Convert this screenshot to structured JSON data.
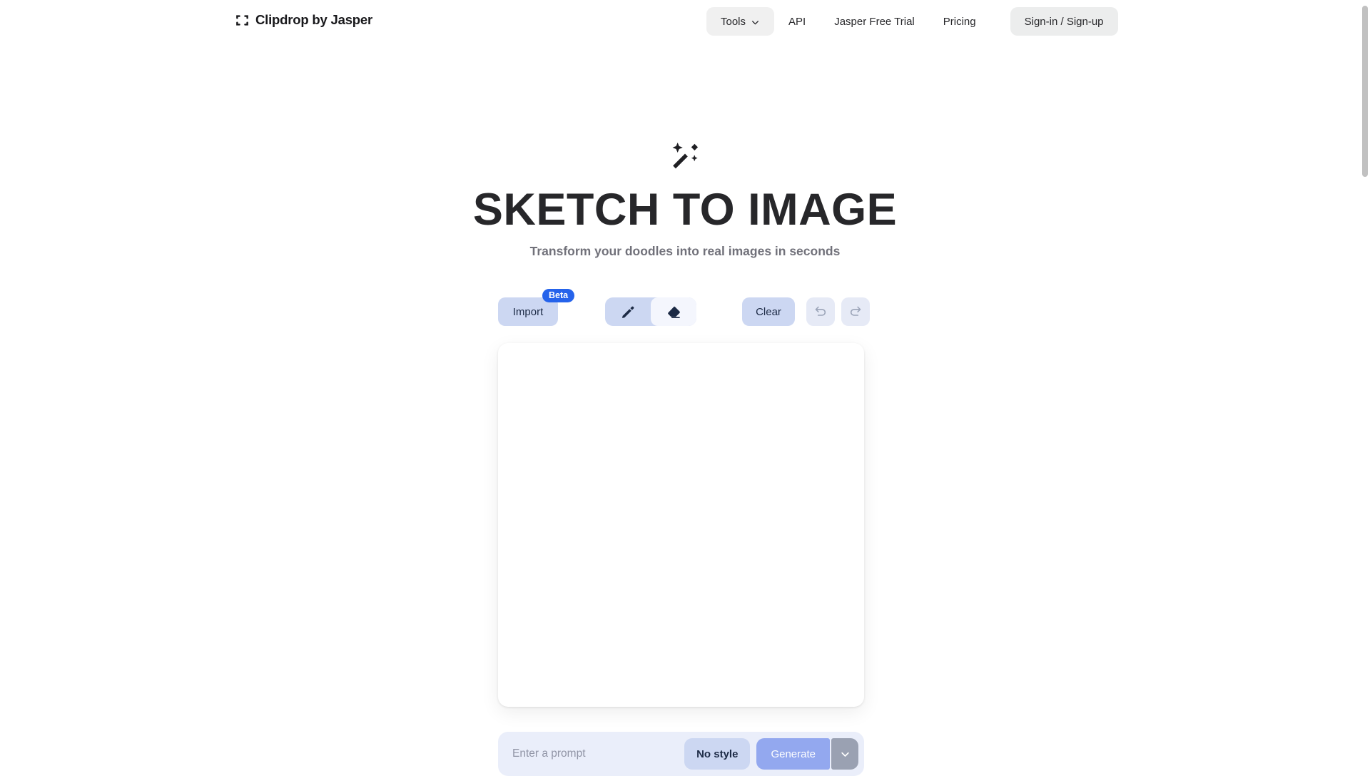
{
  "navbar": {
    "brand": {
      "label": "Clipdrop by Jasper",
      "icon": "crop-brackets-icon"
    },
    "items": [
      {
        "label": "Tools",
        "icon": "chevron-down-icon",
        "style": "pill"
      },
      {
        "label": "API",
        "style": "plain"
      },
      {
        "label": "Jasper Free Trial",
        "style": "plain"
      },
      {
        "label": "Pricing",
        "style": "plain"
      },
      {
        "label": "Sign-in / Sign-up",
        "style": "signin"
      }
    ]
  },
  "hero": {
    "icon": "magic-wand-icon",
    "title": "SKETCH TO IMAGE",
    "subtitle": "Transform your doodles into real images in seconds"
  },
  "toolbar": {
    "import_label": "Import",
    "beta_badge": "Beta",
    "pencil_icon": "pencil-icon",
    "eraser_icon": "eraser-icon",
    "active_tool": "eraser",
    "clear_label": "Clear",
    "undo_icon": "undo-icon",
    "redo_icon": "redo-icon"
  },
  "canvas": {
    "label": "drawing-canvas",
    "content": ""
  },
  "prompt": {
    "placeholder": "Enter a prompt",
    "value": "",
    "style_label": "No style",
    "generate_label": "Generate",
    "caret_icon": "chevron-down-icon"
  },
  "colors": {
    "accent_blue": "#2563eb",
    "button_lavender": "#ccd7f2",
    "generate_blue": "#93a8ef",
    "caret_grey": "#9aa1b2",
    "prompt_bg": "#eaeefa",
    "nav_pill": "#f0f0f0",
    "page_bg": "#ffffff",
    "text_dark": "#27272a",
    "text_muted": "#71717a"
  }
}
